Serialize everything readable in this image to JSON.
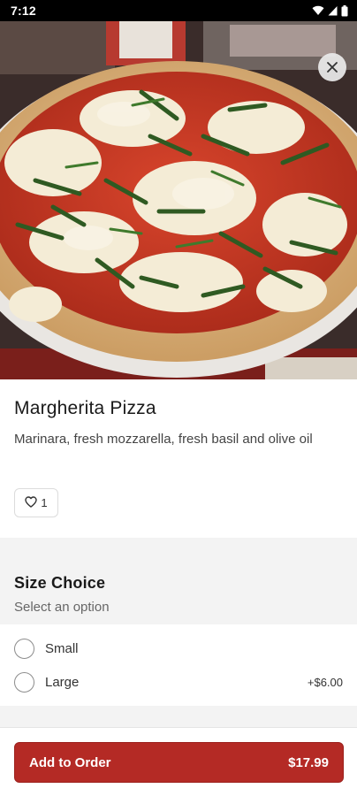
{
  "status_bar": {
    "time": "7:12",
    "icons": [
      "wifi-icon",
      "signal-icon",
      "battery-icon"
    ]
  },
  "hero": {
    "image": "pizza-photo",
    "close_icon": "close-icon"
  },
  "item": {
    "title": "Margherita Pizza",
    "description": "Marinara, fresh mozzarella, fresh basil and olive oil",
    "like_count": "1",
    "like_icon": "heart-icon"
  },
  "size_section": {
    "title": "Size Choice",
    "subtitle": "Select an option",
    "options": [
      {
        "label": "Small",
        "price": ""
      },
      {
        "label": "Large",
        "price": "+$6.00"
      }
    ]
  },
  "footer": {
    "add_label": "Add to Order",
    "price": "$17.99"
  },
  "colors": {
    "accent": "#b42a25",
    "section_background": "#f3f3f3"
  }
}
